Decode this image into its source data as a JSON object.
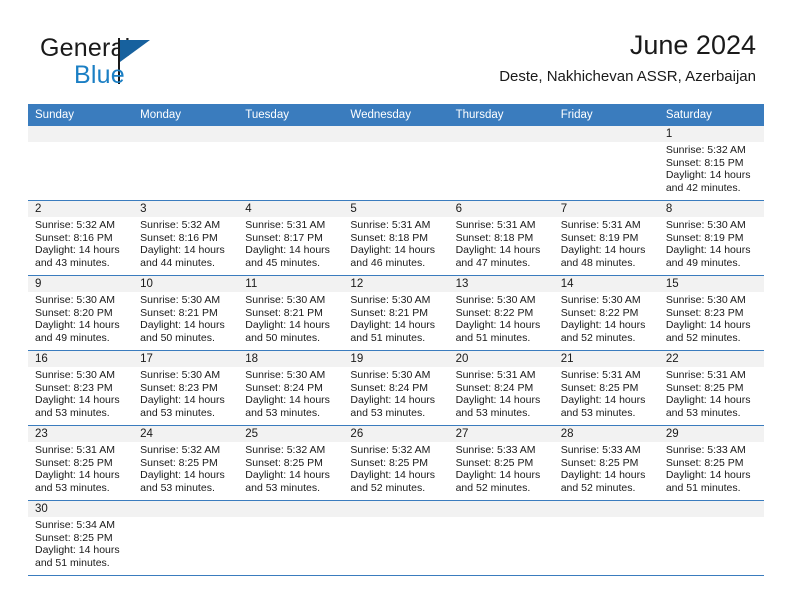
{
  "brand": {
    "name_top": "General",
    "name_bottom": "Blue",
    "accent_color": "#1b7fc4",
    "flag_color": "#17619e"
  },
  "header": {
    "title": "June 2024",
    "subtitle": "Deste, Nakhichevan ASSR, Azerbaijan"
  },
  "theme": {
    "header_bar_color": "#3a7cbe",
    "day_number_bg": "#f2f2f2",
    "grid_line_color": "#3a7cbe",
    "text_color": "#1a1a1a"
  },
  "calendar": {
    "weekdays": [
      "Sunday",
      "Monday",
      "Tuesday",
      "Wednesday",
      "Thursday",
      "Friday",
      "Saturday"
    ],
    "weeks": [
      [
        {
          "empty": true
        },
        {
          "empty": true
        },
        {
          "empty": true
        },
        {
          "empty": true
        },
        {
          "empty": true
        },
        {
          "empty": true
        },
        {
          "day": "1",
          "sunrise": "Sunrise: 5:32 AM",
          "sunset": "Sunset: 8:15 PM",
          "daylight1": "Daylight: 14 hours",
          "daylight2": "and 42 minutes."
        }
      ],
      [
        {
          "day": "2",
          "sunrise": "Sunrise: 5:32 AM",
          "sunset": "Sunset: 8:16 PM",
          "daylight1": "Daylight: 14 hours",
          "daylight2": "and 43 minutes."
        },
        {
          "day": "3",
          "sunrise": "Sunrise: 5:32 AM",
          "sunset": "Sunset: 8:16 PM",
          "daylight1": "Daylight: 14 hours",
          "daylight2": "and 44 minutes."
        },
        {
          "day": "4",
          "sunrise": "Sunrise: 5:31 AM",
          "sunset": "Sunset: 8:17 PM",
          "daylight1": "Daylight: 14 hours",
          "daylight2": "and 45 minutes."
        },
        {
          "day": "5",
          "sunrise": "Sunrise: 5:31 AM",
          "sunset": "Sunset: 8:18 PM",
          "daylight1": "Daylight: 14 hours",
          "daylight2": "and 46 minutes."
        },
        {
          "day": "6",
          "sunrise": "Sunrise: 5:31 AM",
          "sunset": "Sunset: 8:18 PM",
          "daylight1": "Daylight: 14 hours",
          "daylight2": "and 47 minutes."
        },
        {
          "day": "7",
          "sunrise": "Sunrise: 5:31 AM",
          "sunset": "Sunset: 8:19 PM",
          "daylight1": "Daylight: 14 hours",
          "daylight2": "and 48 minutes."
        },
        {
          "day": "8",
          "sunrise": "Sunrise: 5:30 AM",
          "sunset": "Sunset: 8:19 PM",
          "daylight1": "Daylight: 14 hours",
          "daylight2": "and 49 minutes."
        }
      ],
      [
        {
          "day": "9",
          "sunrise": "Sunrise: 5:30 AM",
          "sunset": "Sunset: 8:20 PM",
          "daylight1": "Daylight: 14 hours",
          "daylight2": "and 49 minutes."
        },
        {
          "day": "10",
          "sunrise": "Sunrise: 5:30 AM",
          "sunset": "Sunset: 8:21 PM",
          "daylight1": "Daylight: 14 hours",
          "daylight2": "and 50 minutes."
        },
        {
          "day": "11",
          "sunrise": "Sunrise: 5:30 AM",
          "sunset": "Sunset: 8:21 PM",
          "daylight1": "Daylight: 14 hours",
          "daylight2": "and 50 minutes."
        },
        {
          "day": "12",
          "sunrise": "Sunrise: 5:30 AM",
          "sunset": "Sunset: 8:21 PM",
          "daylight1": "Daylight: 14 hours",
          "daylight2": "and 51 minutes."
        },
        {
          "day": "13",
          "sunrise": "Sunrise: 5:30 AM",
          "sunset": "Sunset: 8:22 PM",
          "daylight1": "Daylight: 14 hours",
          "daylight2": "and 51 minutes."
        },
        {
          "day": "14",
          "sunrise": "Sunrise: 5:30 AM",
          "sunset": "Sunset: 8:22 PM",
          "daylight1": "Daylight: 14 hours",
          "daylight2": "and 52 minutes."
        },
        {
          "day": "15",
          "sunrise": "Sunrise: 5:30 AM",
          "sunset": "Sunset: 8:23 PM",
          "daylight1": "Daylight: 14 hours",
          "daylight2": "and 52 minutes."
        }
      ],
      [
        {
          "day": "16",
          "sunrise": "Sunrise: 5:30 AM",
          "sunset": "Sunset: 8:23 PM",
          "daylight1": "Daylight: 14 hours",
          "daylight2": "and 53 minutes."
        },
        {
          "day": "17",
          "sunrise": "Sunrise: 5:30 AM",
          "sunset": "Sunset: 8:23 PM",
          "daylight1": "Daylight: 14 hours",
          "daylight2": "and 53 minutes."
        },
        {
          "day": "18",
          "sunrise": "Sunrise: 5:30 AM",
          "sunset": "Sunset: 8:24 PM",
          "daylight1": "Daylight: 14 hours",
          "daylight2": "and 53 minutes."
        },
        {
          "day": "19",
          "sunrise": "Sunrise: 5:30 AM",
          "sunset": "Sunset: 8:24 PM",
          "daylight1": "Daylight: 14 hours",
          "daylight2": "and 53 minutes."
        },
        {
          "day": "20",
          "sunrise": "Sunrise: 5:31 AM",
          "sunset": "Sunset: 8:24 PM",
          "daylight1": "Daylight: 14 hours",
          "daylight2": "and 53 minutes."
        },
        {
          "day": "21",
          "sunrise": "Sunrise: 5:31 AM",
          "sunset": "Sunset: 8:25 PM",
          "daylight1": "Daylight: 14 hours",
          "daylight2": "and 53 minutes."
        },
        {
          "day": "22",
          "sunrise": "Sunrise: 5:31 AM",
          "sunset": "Sunset: 8:25 PM",
          "daylight1": "Daylight: 14 hours",
          "daylight2": "and 53 minutes."
        }
      ],
      [
        {
          "day": "23",
          "sunrise": "Sunrise: 5:31 AM",
          "sunset": "Sunset: 8:25 PM",
          "daylight1": "Daylight: 14 hours",
          "daylight2": "and 53 minutes."
        },
        {
          "day": "24",
          "sunrise": "Sunrise: 5:32 AM",
          "sunset": "Sunset: 8:25 PM",
          "daylight1": "Daylight: 14 hours",
          "daylight2": "and 53 minutes."
        },
        {
          "day": "25",
          "sunrise": "Sunrise: 5:32 AM",
          "sunset": "Sunset: 8:25 PM",
          "daylight1": "Daylight: 14 hours",
          "daylight2": "and 53 minutes."
        },
        {
          "day": "26",
          "sunrise": "Sunrise: 5:32 AM",
          "sunset": "Sunset: 8:25 PM",
          "daylight1": "Daylight: 14 hours",
          "daylight2": "and 52 minutes."
        },
        {
          "day": "27",
          "sunrise": "Sunrise: 5:33 AM",
          "sunset": "Sunset: 8:25 PM",
          "daylight1": "Daylight: 14 hours",
          "daylight2": "and 52 minutes."
        },
        {
          "day": "28",
          "sunrise": "Sunrise: 5:33 AM",
          "sunset": "Sunset: 8:25 PM",
          "daylight1": "Daylight: 14 hours",
          "daylight2": "and 52 minutes."
        },
        {
          "day": "29",
          "sunrise": "Sunrise: 5:33 AM",
          "sunset": "Sunset: 8:25 PM",
          "daylight1": "Daylight: 14 hours",
          "daylight2": "and 51 minutes."
        }
      ],
      [
        {
          "day": "30",
          "sunrise": "Sunrise: 5:34 AM",
          "sunset": "Sunset: 8:25 PM",
          "daylight1": "Daylight: 14 hours",
          "daylight2": "and 51 minutes."
        },
        {
          "empty": true
        },
        {
          "empty": true
        },
        {
          "empty": true
        },
        {
          "empty": true
        },
        {
          "empty": true
        },
        {
          "empty": true
        }
      ]
    ]
  }
}
